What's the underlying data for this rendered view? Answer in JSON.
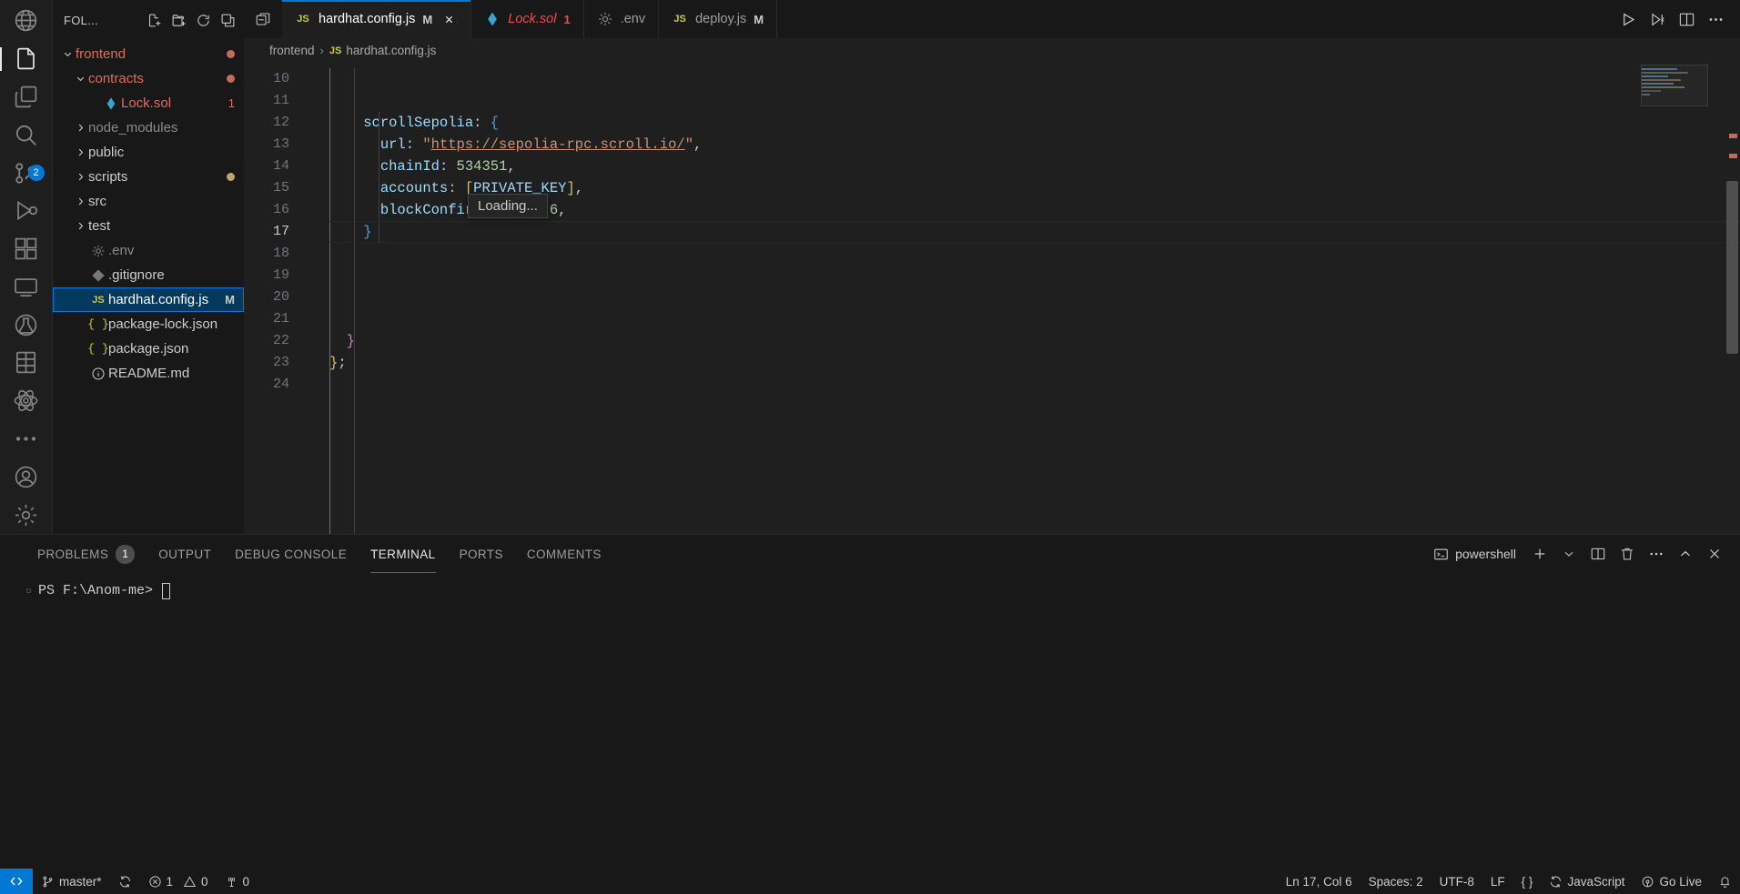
{
  "activitybar": {
    "items": [
      {
        "name": "extension-marketplace-globe-icon",
        "icon": "globe",
        "active": false,
        "badge": null
      },
      {
        "name": "explorer-icon",
        "icon": "files",
        "active": true,
        "badge": null
      },
      {
        "name": "source-control-graph-icon",
        "icon": "copy",
        "active": false,
        "badge": null
      },
      {
        "name": "search-icon",
        "icon": "search",
        "active": false,
        "badge": null
      },
      {
        "name": "source-control-icon",
        "icon": "source-control",
        "active": false,
        "badge": "2"
      },
      {
        "name": "run-and-debug-icon",
        "icon": "debug",
        "active": false,
        "badge": null
      },
      {
        "name": "extensions-icon",
        "icon": "extensions",
        "active": false,
        "badge": null
      },
      {
        "name": "remote-explorer-icon",
        "icon": "remote",
        "active": false,
        "badge": null
      },
      {
        "name": "testing-icon",
        "icon": "beaker-circle",
        "active": false,
        "badge": null
      },
      {
        "name": "figma-icon",
        "icon": "figma",
        "active": false,
        "badge": null
      },
      {
        "name": "react-icon",
        "icon": "atom",
        "active": false,
        "badge": null
      },
      {
        "name": "more-views-icon",
        "icon": "ellipsis",
        "active": false,
        "badge": null
      }
    ],
    "bottom": [
      {
        "name": "accounts-icon",
        "icon": "account"
      },
      {
        "name": "settings-gear-icon",
        "icon": "gear"
      }
    ]
  },
  "sidebar": {
    "title": "FOL...",
    "actions": [
      {
        "name": "new-file-button",
        "icon": "new-file"
      },
      {
        "name": "new-folder-button",
        "icon": "new-folder"
      },
      {
        "name": "refresh-explorer-button",
        "icon": "refresh"
      },
      {
        "name": "collapse-folders-button",
        "icon": "collapse-all"
      }
    ],
    "tree": [
      {
        "label": "frontend",
        "indent": 0,
        "type": "folder",
        "expanded": true,
        "color": "#e06c5e",
        "dot": "#c66b5a",
        "selected": false
      },
      {
        "label": "contracts",
        "indent": 1,
        "type": "folder",
        "expanded": true,
        "color": "#e06c5e",
        "dot": "#c66b5a",
        "selected": false
      },
      {
        "label": "Lock.sol",
        "indent": 2,
        "type": "sol",
        "expanded": null,
        "color": "#e06c5e",
        "count": "1",
        "selected": false
      },
      {
        "label": "node_modules",
        "indent": 1,
        "type": "folder",
        "expanded": false,
        "color": "#8a8a8a",
        "selected": false
      },
      {
        "label": "public",
        "indent": 1,
        "type": "folder",
        "expanded": false,
        "color": "#cccccc",
        "selected": false
      },
      {
        "label": "scripts",
        "indent": 1,
        "type": "folder",
        "expanded": false,
        "color": "#cccccc",
        "dot": "#bfa46a",
        "selected": false
      },
      {
        "label": "src",
        "indent": 1,
        "type": "folder",
        "expanded": false,
        "color": "#cccccc",
        "selected": false
      },
      {
        "label": "test",
        "indent": 1,
        "type": "folder",
        "expanded": false,
        "color": "#cccccc",
        "selected": false
      },
      {
        "label": ".env",
        "indent": 1,
        "type": "gear",
        "expanded": null,
        "color": "#8a8a8a",
        "selected": false
      },
      {
        "label": ".gitignore",
        "indent": 1,
        "type": "git",
        "expanded": null,
        "color": "#cccccc",
        "selected": false
      },
      {
        "label": "hardhat.config.js",
        "indent": 1,
        "type": "js",
        "expanded": null,
        "color": "#ffffff",
        "mark": "M",
        "selected": true
      },
      {
        "label": "package-lock.json",
        "indent": 1,
        "type": "json",
        "expanded": null,
        "color": "#cccccc",
        "selected": false
      },
      {
        "label": "package.json",
        "indent": 1,
        "type": "json",
        "expanded": null,
        "color": "#cccccc",
        "selected": false
      },
      {
        "label": "README.md",
        "indent": 1,
        "type": "info",
        "expanded": null,
        "color": "#cccccc",
        "selected": false
      }
    ]
  },
  "tabs": [
    {
      "label": "hardhat.config.js",
      "icon": "js",
      "mark": "M",
      "error": null,
      "active": true,
      "italic": false,
      "closable": true
    },
    {
      "label": "Lock.sol",
      "icon": "sol",
      "mark": null,
      "error": "1",
      "active": false,
      "italic": true,
      "closable": false
    },
    {
      "label": ".env",
      "icon": "gear",
      "mark": null,
      "error": null,
      "active": false,
      "italic": false,
      "closable": false
    },
    {
      "label": "deploy.js",
      "icon": "js",
      "mark": "M",
      "error": null,
      "active": false,
      "italic": false,
      "closable": false
    }
  ],
  "editor_actions": [
    {
      "name": "run-button",
      "icon": "play"
    },
    {
      "name": "run-or-debug-split-icon",
      "icon": "debug-alt"
    },
    {
      "name": "split-editor-right-button",
      "icon": "split"
    },
    {
      "name": "more-actions-button",
      "icon": "ellipsis"
    }
  ],
  "breadcrumb": [
    {
      "label": "frontend",
      "icon": null
    },
    {
      "label": "hardhat.config.js",
      "icon": "js"
    }
  ],
  "code": {
    "first_line": 10,
    "cursor_line": 17,
    "lines": [
      {
        "n": 10,
        "tokens": []
      },
      {
        "n": 11,
        "tokens": []
      },
      {
        "n": 12,
        "tokens": [
          {
            "t": "    ",
            "c": "punc"
          },
          {
            "t": "scrollSepolia",
            "c": "prop"
          },
          {
            "t": ": ",
            "c": "punc"
          },
          {
            "t": "{",
            "c": "brace-b"
          }
        ]
      },
      {
        "n": 13,
        "tokens": [
          {
            "t": "      ",
            "c": "punc"
          },
          {
            "t": "url",
            "c": "prop"
          },
          {
            "t": ": ",
            "c": "punc"
          },
          {
            "t": "\"",
            "c": "str"
          },
          {
            "t": "https://sepolia-rpc.scroll.io/",
            "c": "link"
          },
          {
            "t": "\"",
            "c": "str"
          },
          {
            "t": ",",
            "c": "punc"
          }
        ]
      },
      {
        "n": 14,
        "tokens": [
          {
            "t": "      ",
            "c": "punc"
          },
          {
            "t": "chainId",
            "c": "prop"
          },
          {
            "t": ": ",
            "c": "punc"
          },
          {
            "t": "534351",
            "c": "num"
          },
          {
            "t": ",",
            "c": "punc"
          }
        ]
      },
      {
        "n": 15,
        "tokens": [
          {
            "t": "      ",
            "c": "punc"
          },
          {
            "t": "accounts",
            "c": "prop"
          },
          {
            "t": ": [",
            "c": "brace-y"
          },
          {
            "t": "PRIVATE_KEY",
            "c": "prop"
          },
          {
            "t": "]",
            "c": "brace-y"
          },
          {
            "t": ",",
            "c": "punc"
          }
        ]
      },
      {
        "n": 16,
        "tokens": [
          {
            "t": "      ",
            "c": "punc"
          },
          {
            "t": "blockConfirmations",
            "c": "prop"
          },
          {
            "t": ": ",
            "c": "punc"
          },
          {
            "t": "6",
            "c": "num"
          },
          {
            "t": ",",
            "c": "punc"
          }
        ]
      },
      {
        "n": 17,
        "tokens": [
          {
            "t": "    ",
            "c": "punc"
          },
          {
            "t": "}",
            "c": "brace-b"
          }
        ]
      },
      {
        "n": 18,
        "tokens": []
      },
      {
        "n": 19,
        "tokens": []
      },
      {
        "n": 20,
        "tokens": []
      },
      {
        "n": 21,
        "tokens": []
      },
      {
        "n": 22,
        "tokens": [
          {
            "t": "  ",
            "c": "punc"
          },
          {
            "t": "}",
            "c": "brace-p"
          }
        ]
      },
      {
        "n": 23,
        "tokens": [
          {
            "t": "}",
            "c": "brace-y"
          },
          {
            "t": ";",
            "c": "punc"
          }
        ]
      },
      {
        "n": 24,
        "tokens": []
      }
    ],
    "tooltip": "Loading..."
  },
  "panel": {
    "tabs": [
      {
        "label": "PROBLEMS",
        "badge": "1",
        "active": false
      },
      {
        "label": "OUTPUT",
        "badge": null,
        "active": false
      },
      {
        "label": "DEBUG CONSOLE",
        "badge": null,
        "active": false
      },
      {
        "label": "TERMINAL",
        "badge": null,
        "active": true
      },
      {
        "label": "PORTS",
        "badge": null,
        "active": false
      },
      {
        "label": "COMMENTS",
        "badge": null,
        "active": false
      }
    ],
    "shell": "powershell",
    "actions": [
      {
        "name": "new-terminal-button",
        "icon": "plus"
      },
      {
        "name": "terminal-profile-dropdown",
        "icon": "chevron-down"
      },
      {
        "name": "split-terminal-button",
        "icon": "split"
      },
      {
        "name": "kill-terminal-button",
        "icon": "trash"
      },
      {
        "name": "terminal-more-actions-button",
        "icon": "ellipsis"
      },
      {
        "name": "maximize-panel-button",
        "icon": "chevron-up"
      },
      {
        "name": "close-panel-button",
        "icon": "close"
      }
    ],
    "terminal": {
      "prompt": "PS F:\\Anom-me>",
      "command": ""
    }
  },
  "statusbar": {
    "left": [
      {
        "name": "remote-window-indicator",
        "label": "",
        "icon": "remote"
      },
      {
        "name": "git-branch-status",
        "label": "master*",
        "icon": "branch"
      },
      {
        "name": "sync-changes-button",
        "label": "",
        "icon": "sync"
      },
      {
        "name": "problems-status",
        "label": "1  0",
        "icon": "error-warning"
      },
      {
        "name": "ports-status",
        "label": "0",
        "icon": "radio-tower"
      }
    ],
    "left_values": {
      "branch": "master*",
      "errors": "1",
      "warnings": "0",
      "ports": "0"
    },
    "right": [
      {
        "name": "editor-position-status",
        "label": "Ln 17, Col 6",
        "icon": null
      },
      {
        "name": "indentation-status",
        "label": "Spaces: 2",
        "icon": null
      },
      {
        "name": "encoding-status",
        "label": "UTF-8",
        "icon": null
      },
      {
        "name": "eol-status",
        "label": "LF",
        "icon": null
      },
      {
        "name": "prettier-status",
        "label": "{ }",
        "icon": null
      },
      {
        "name": "language-mode-status",
        "label": "JavaScript",
        "icon": "sync"
      },
      {
        "name": "go-live-status",
        "label": "Go Live",
        "icon": "broadcast"
      },
      {
        "name": "notifications-bell-icon",
        "label": "",
        "icon": "bell"
      }
    ]
  },
  "colors": {
    "accent": "#0078d4",
    "selection": "#04395e",
    "modified": "#e06c5e",
    "error": "#f14c4c",
    "string": "#ce9178"
  }
}
